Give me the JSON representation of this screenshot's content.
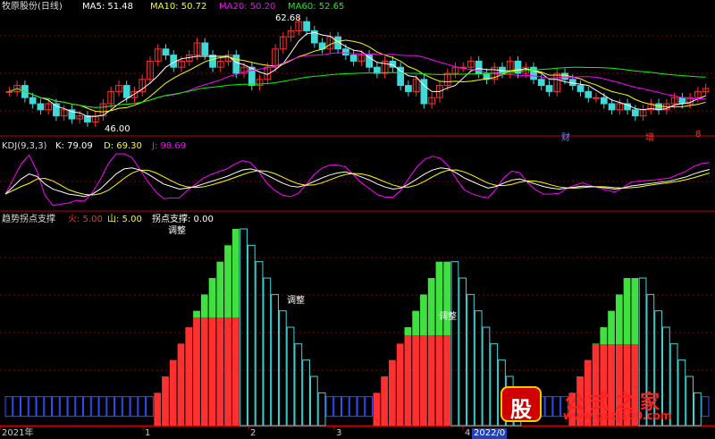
{
  "panels": {
    "price": {
      "title": "牧原股份(日线)",
      "ma": [
        {
          "label": "MA5: 51.48",
          "color": "#ffffff"
        },
        {
          "label": "MA10: 50.72",
          "color": "#ffff00"
        },
        {
          "label": "MA20: 50.20",
          "color": "#ff00ff"
        },
        {
          "label": "MA60: 52.65",
          "color": "#00ff00"
        }
      ],
      "annotations": {
        "high": "62.68",
        "low": "46.00",
        "marks": [
          "财",
          "增",
          "8"
        ]
      }
    },
    "kdj": {
      "title": "KDJ(9,3,3)",
      "values": [
        {
          "label": "K: 79.09",
          "color": "#ffffff"
        },
        {
          "label": "D: 69.30",
          "color": "#ffff00"
        },
        {
          "label": "J: 98.69",
          "color": "#ff00ff"
        }
      ]
    },
    "trend": {
      "title": "趋势拐点支撑",
      "values": [
        {
          "label": "火: 5.00",
          "color": "#ff3030"
        },
        {
          "label": "山: 5.00",
          "color": "#ffff00"
        },
        {
          "label": "拐点支撑: 0.00",
          "color": "#ffffff"
        }
      ],
      "annotations": [
        "调整",
        "调整",
        "调整"
      ]
    }
  },
  "x_axis": {
    "ticks": [
      "2021年",
      "1",
      "2",
      "3",
      "4",
      "2022/0"
    ]
  },
  "watermark": {
    "logo": "股",
    "text": "公式之家",
    "url": "www.gszj100.com"
  },
  "colors": {
    "up": "#ff3030",
    "down": "#40d8d8",
    "green_bar": "#40e040",
    "blue_bar": "#3050ff",
    "grid": "#8b0000"
  },
  "chart_data": [
    {
      "type": "candlestick",
      "title": "牧原股份(日线)",
      "series": [
        {
          "name": "MA5",
          "last": 51.48
        },
        {
          "name": "MA10",
          "last": 50.72
        },
        {
          "name": "MA20",
          "last": 50.2
        },
        {
          "name": "MA60",
          "last": 52.65
        }
      ],
      "close": [
        51,
        52,
        50,
        49,
        48,
        49,
        47,
        48,
        46.5,
        47,
        46,
        47,
        49,
        51,
        52,
        50,
        51,
        53,
        56,
        58,
        57,
        55,
        56,
        57,
        59,
        57,
        55,
        56,
        57,
        54,
        55,
        52,
        53,
        55,
        58,
        60,
        61,
        62.5,
        61,
        59,
        58,
        60,
        58,
        57,
        56,
        57,
        55,
        54,
        56,
        55,
        52,
        51,
        53,
        49,
        50,
        52,
        54,
        55,
        55,
        56,
        54,
        53,
        55,
        54,
        56,
        54,
        55,
        53,
        52,
        51,
        54,
        53,
        52,
        51,
        50,
        50,
        49,
        48,
        49,
        48,
        47,
        48,
        49,
        48,
        49,
        50,
        49,
        50,
        51,
        51.5
      ],
      "annotations": [
        "62.68",
        "46.00"
      ]
    },
    {
      "type": "line",
      "title": "KDJ(9,3,3)",
      "series": [
        {
          "name": "K",
          "last": 79.09
        },
        {
          "name": "D",
          "last": 69.3
        },
        {
          "name": "J",
          "last": 98.69
        }
      ],
      "k": [
        30,
        45,
        60,
        70,
        65,
        50,
        40,
        35,
        30,
        28,
        25,
        30,
        40,
        55,
        70,
        80,
        82,
        78,
        70,
        60,
        50,
        45,
        40,
        42,
        45,
        50,
        55,
        60,
        65,
        72,
        78,
        80,
        76,
        68,
        60,
        52,
        46,
        44,
        48,
        55,
        62,
        68,
        72,
        74,
        70,
        64,
        58,
        50,
        44,
        40,
        42,
        50,
        60,
        70,
        78,
        82,
        80,
        72,
        62,
        55,
        48,
        42,
        45,
        52,
        58,
        60,
        55,
        50,
        45,
        42,
        40,
        42,
        44,
        46,
        45,
        44,
        42,
        40,
        42,
        46,
        48,
        50,
        52,
        54,
        56,
        60,
        64,
        70,
        75,
        79
      ]
    },
    {
      "type": "bar",
      "title": "趋势拐点支撑",
      "series": [
        {
          "name": "火",
          "last": 5.0
        },
        {
          "name": "山",
          "last": 5.0
        },
        {
          "name": "拐点支撑",
          "last": 0.0
        }
      ],
      "values": [
        1,
        1,
        1,
        1,
        1,
        1,
        1,
        1,
        1,
        1,
        1,
        1,
        1,
        1,
        1,
        1,
        1,
        1,
        1,
        2,
        3,
        4,
        5,
        6,
        7,
        8,
        9,
        10,
        11,
        12,
        12,
        11,
        10,
        9,
        8,
        7,
        6,
        5,
        4,
        3,
        2,
        1,
        1,
        1,
        1,
        1,
        1,
        2,
        3,
        4,
        5,
        6,
        7,
        8,
        9,
        10,
        10,
        10,
        9,
        8,
        7,
        6,
        5,
        4,
        3,
        2,
        1,
        1,
        1,
        1,
        1,
        1,
        2,
        3,
        4,
        5,
        6,
        7,
        8,
        9,
        9,
        9,
        8,
        7,
        6,
        5,
        4,
        3,
        2,
        1
      ]
    }
  ]
}
